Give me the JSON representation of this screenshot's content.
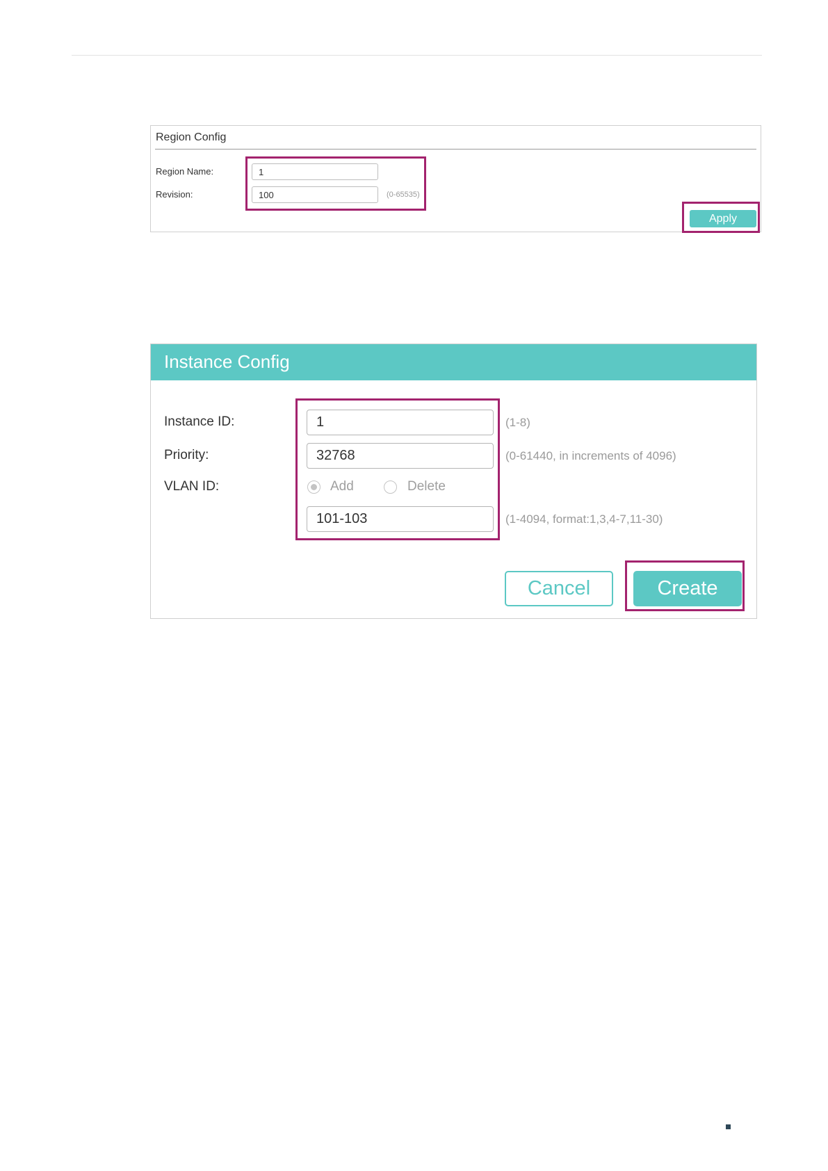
{
  "region_config": {
    "title": "Region Config",
    "region_name_label": "Region Name:",
    "region_name_value": "1",
    "revision_label": "Revision:",
    "revision_value": "100",
    "revision_hint": "(0-65535)",
    "apply_label": "Apply"
  },
  "instance_config": {
    "title": "Instance Config",
    "instance_id_label": "Instance ID:",
    "instance_id_value": "1",
    "instance_id_hint": "(1-8)",
    "priority_label": "Priority:",
    "priority_value": "32768",
    "priority_hint": "(0-61440, in increments of 4096)",
    "vlan_id_label": "VLAN ID:",
    "vlan_add_label": "Add",
    "vlan_delete_label": "Delete",
    "vlan_selected": "Add",
    "vlan_value": "101-103",
    "vlan_hint": "(1-4094, format:1,3,4-7,11-30)",
    "cancel_label": "Cancel",
    "create_label": "Create"
  },
  "colors": {
    "accent": "#5cc8c4",
    "highlight": "#a3236e"
  }
}
